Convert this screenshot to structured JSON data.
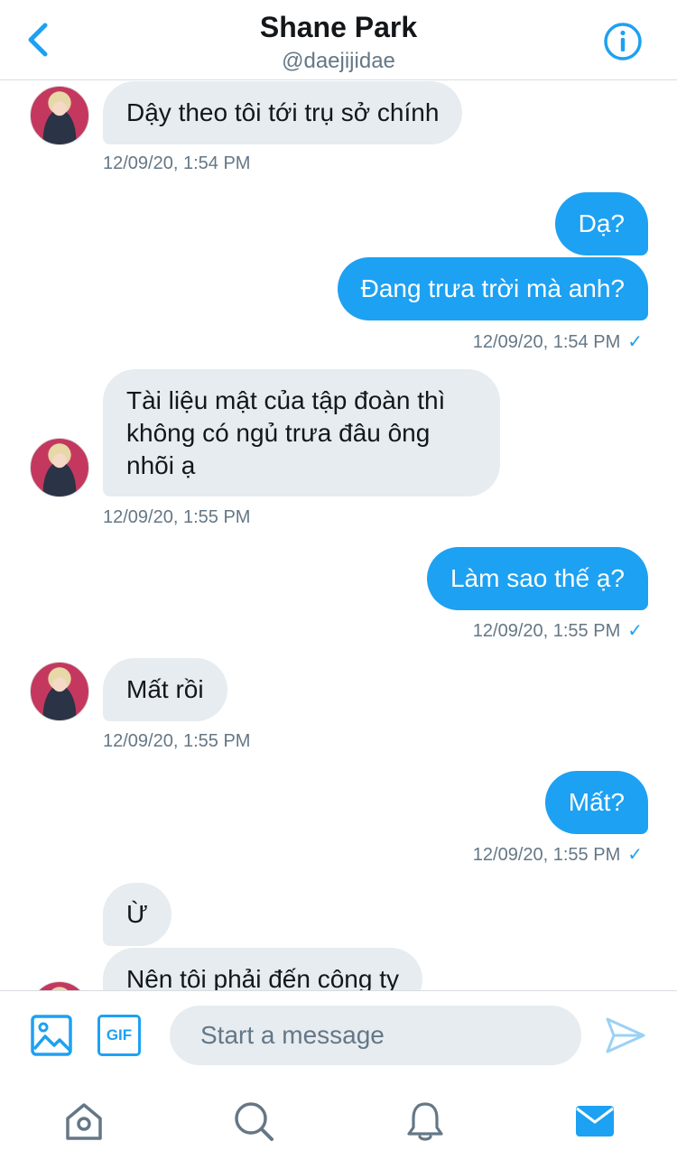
{
  "header": {
    "title": "Shane Park",
    "handle": "@daejijidae"
  },
  "messages": [
    {
      "side": "in",
      "text": "Dậy theo tôi tới trụ sở chính",
      "timestamp": "12/09/20, 1:54 PM"
    },
    {
      "side": "out",
      "text": "Dạ?"
    },
    {
      "side": "out",
      "text": "Đang trưa trời mà anh?",
      "timestamp": "12/09/20, 1:54 PM",
      "check": "✓"
    },
    {
      "side": "in",
      "text": "Tài liệu mật của tập đoàn thì không có ngủ trưa đâu ông nhõi ạ",
      "timestamp": "12/09/20, 1:55 PM"
    },
    {
      "side": "out",
      "text": "Làm sao thế ạ?",
      "timestamp": "12/09/20, 1:55 PM",
      "check": "✓"
    },
    {
      "side": "in",
      "text": "Mất rồi",
      "timestamp": "12/09/20, 1:55 PM"
    },
    {
      "side": "out",
      "text": "Mất?",
      "timestamp": "12/09/20, 1:55 PM",
      "check": "✓"
    },
    {
      "side": "in",
      "text": "Ừ"
    },
    {
      "side": "in",
      "text": "Nên tôi phải đến công ty"
    }
  ],
  "composer": {
    "placeholder": "Start a message",
    "gif_label": "GIF"
  },
  "icons": {
    "back": "chevron-left-icon",
    "info": "info-icon",
    "image": "image-icon",
    "gif": "gif-icon",
    "send": "send-icon",
    "home": "home-icon",
    "search": "search-icon",
    "notifications": "bell-icon",
    "messages": "mail-icon"
  },
  "colors": {
    "accent": "#1da1f2",
    "incoming_bubble": "#e6ecf0",
    "secondary_text": "#657786"
  }
}
